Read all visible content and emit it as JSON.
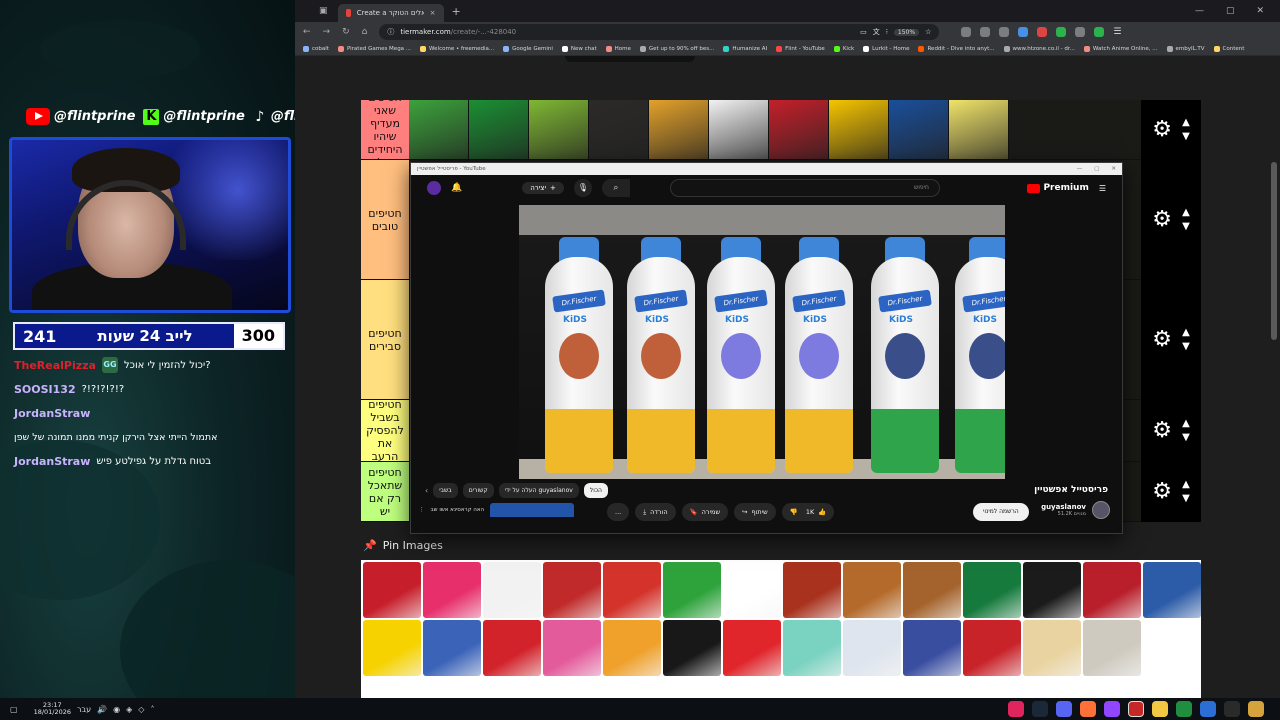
{
  "overlay": {
    "socials": [
      {
        "icon": "youtube-icon",
        "handle": "@flintprine"
      },
      {
        "icon": "kick-icon",
        "handle": "@flintprine"
      },
      {
        "icon": "tiktok-icon",
        "handle": "@flintprine"
      }
    ],
    "subathon": {
      "left_count": "241",
      "label": "לייב 24 שעות",
      "right_count": "300"
    },
    "chat": [
      {
        "user": "TheRealPizza",
        "user_color": "#e0202a",
        "badge": "GG",
        "message": "יכול להזמין לי אוכל?"
      },
      {
        "user": "SOOSI132",
        "user_color": "#c9b3ff",
        "badge": "",
        "message": "?!?!?!?!?"
      },
      {
        "user": "JordanStraw",
        "user_color": "#c9b3ff",
        "badge": "",
        "message": ""
      },
      {
        "user": "",
        "user_color": "#ffffff",
        "badge": "",
        "message": "אתמול הייתי אצל הירקן קניתי ממנו תמונה של שפן"
      },
      {
        "user": "JordanStraw",
        "user_color": "#c9b3ff",
        "badge": "",
        "message": "בטוח גדלת על גפילטע פיש"
      }
    ]
  },
  "browser": {
    "tab": {
      "title": "Create a חטיפים ישראלים הטוקר",
      "close": "×"
    },
    "new_tab": "+",
    "url": {
      "host": "tiermaker.com",
      "path": "/create/-...-428040"
    },
    "zoom": "150%",
    "bookmarks": [
      {
        "label": "cobalt",
        "color": "#8ab4f8"
      },
      {
        "label": "Pirated Games Mega ...",
        "color": "#f28b82"
      },
      {
        "label": "Welcome • freemedia...",
        "color": "#fdd663"
      },
      {
        "label": "Google Gemini",
        "color": "#8ab4f8"
      },
      {
        "label": "New chat",
        "color": "#ffffff"
      },
      {
        "label": "Home",
        "color": "#f28b82"
      },
      {
        "label": "Get up to 90% off bes...",
        "color": "#aaaaaa"
      },
      {
        "label": "Humanize AI",
        "color": "#34d3c6"
      },
      {
        "label": "Flint - YouTube",
        "color": "#ff4444"
      },
      {
        "label": "Kick",
        "color": "#53fc18"
      },
      {
        "label": "Lurkit - Home",
        "color": "#ffffff"
      },
      {
        "label": "Reddit - Dive into anyt...",
        "color": "#ff5700"
      },
      {
        "label": "www.htzone.co.il - dr...",
        "color": "#aaaaaa"
      },
      {
        "label": "Watch Anime Online, ...",
        "color": "#f28b82"
      },
      {
        "label": "embyIL.TV",
        "color": "#aaaaaa"
      },
      {
        "label": "Content",
        "color": "#fdd663"
      }
    ]
  },
  "tiers": [
    {
      "label": "חטיפים שאני מעדיף שיהיו היחידים בעולם",
      "color": "#ff7f7f"
    },
    {
      "label": "חטיפים טובים",
      "color": "#ffbf7f"
    },
    {
      "label": "חטיפים סבירים",
      "color": "#ffdf7f"
    },
    {
      "label": "חטיפים בשביל להפסיק את הרעב",
      "color": "#ffff7f"
    },
    {
      "label": "חטיפים שתאכל רק אם יש",
      "color": "#bfff7f"
    }
  ],
  "top_items": [
    "#3ca23c",
    "#1b8f33",
    "#7fb733",
    "#2b2a28",
    "#e2a12a",
    "#f2f2f2",
    "#c4202a",
    "#f5c400",
    "#1a4f9a",
    "#f0e36a"
  ],
  "pin": {
    "label": "Pin Images",
    "icon": "pin-icon"
  },
  "pool_items_row1": [
    "#c61f2b",
    "#e72f6b",
    "#f2f2f2",
    "#c02a2a",
    "#d3332b",
    "#2ea33c",
    "#ffffff",
    "#a8321e",
    "#b46a2a",
    "#a4632c",
    "#157a3c",
    "#1b1b1b",
    "#b81f2b",
    "#2c5ba7"
  ],
  "pool_items_row2": [
    "#f6d200",
    "#3b63b8",
    "#d2222a",
    "#e45b9c",
    "#f0a12c",
    "#181818",
    "#e0252b",
    "#7ad2c0",
    "#dfe5ee",
    "#3a4ea0",
    "#c9232a",
    "#e9d3a0",
    "#cfcac0"
  ],
  "youtube": {
    "window_title": "פריסטייל אפשטיין - YouTube",
    "brand": "Premium",
    "search_placeholder": "חיפוש",
    "create_label": "יצירה",
    "video_title": "פריסטייל אפשטיין",
    "channel_name": "guyaslanov",
    "channel_subs": "51.2K מנויים",
    "subscribe_label": "הרשמה למינוי",
    "likes": "1K",
    "share_label": "שיתוף",
    "save_label": "שמירה",
    "download_label": "הורדה",
    "more_label": "...",
    "chips": [
      "הכול",
      "העלה על ידי guyaslanov",
      "קשורים",
      "בשבי"
    ],
    "related_title": "האה קראסינא אשו שב",
    "bottles": [
      {
        "cap": "#3f86d8",
        "bottom": "#f0b929",
        "char": "#c0603a"
      },
      {
        "cap": "#3f86d8",
        "bottom": "#f0b929",
        "char": "#c0603a"
      },
      {
        "cap": "#3f86d8",
        "bottom": "#f0b929",
        "char": "#7d7be0"
      },
      {
        "cap": "#3f86d8",
        "bottom": "#f0b929",
        "char": "#7d7be0"
      },
      {
        "cap": "#3f86d8",
        "bottom": "#2fa44a",
        "char": "#3a4f8a"
      },
      {
        "cap": "#3f86d8",
        "bottom": "#2fa44a",
        "char": "#3a4f8a"
      }
    ]
  },
  "taskbar": {
    "lang": "עבר",
    "time": "23:17",
    "date": "18/01/2026"
  }
}
